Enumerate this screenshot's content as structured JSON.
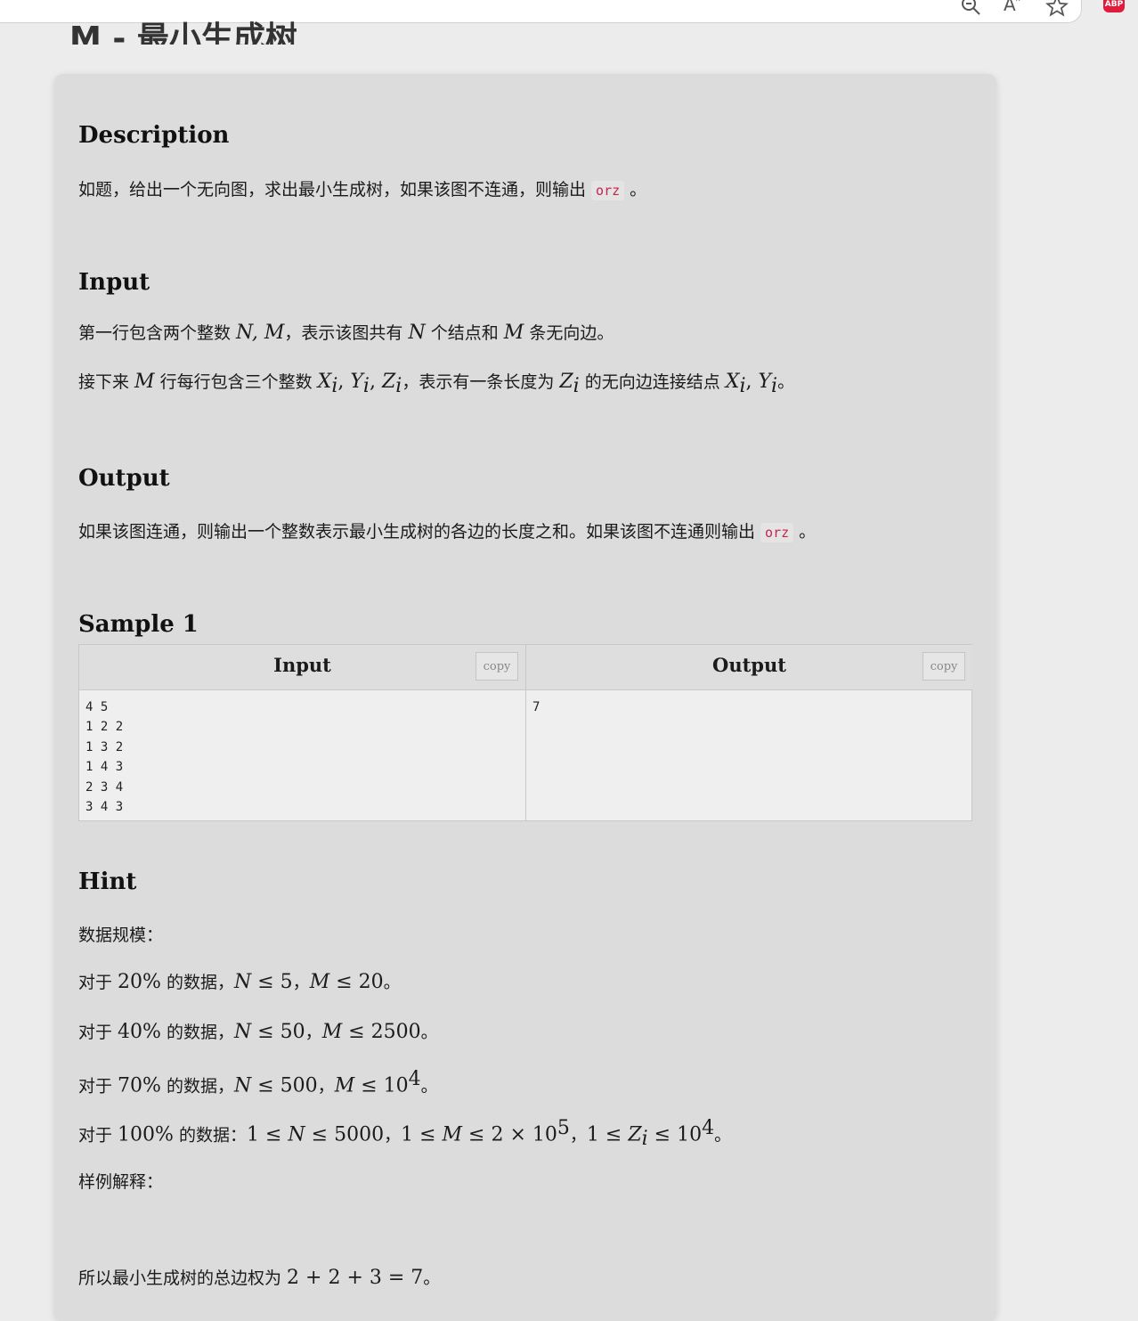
{
  "page": {
    "title": "M - 最小生成树"
  },
  "sections": {
    "description": {
      "title": "Description",
      "text_before": "如题，给出一个无向图，求出最小生成树，如果该图不连通，则输出 ",
      "code": "orz",
      "text_after": " 。"
    },
    "input": {
      "title": "Input",
      "line1": {
        "t1": "第一行包含两个整数 ",
        "m1": "N, M",
        "t2": "，表示该图共有 ",
        "m2": "N",
        "t3": " 个结点和 ",
        "m3": "M",
        "t4": " 条无向边。"
      },
      "line2": {
        "t1": "接下来 ",
        "m1": "M",
        "t2": " 行每行包含三个整数 ",
        "x": "X",
        "y": "Y",
        "z": "Z",
        "sub": "i",
        "t3": "，表示有一条长度为 ",
        "t4": " 的无向边连接结点 ",
        "t5": "。"
      }
    },
    "output": {
      "title": "Output",
      "text_before": "如果该图连通，则输出一个整数表示最小生成树的各边的长度之和。如果该图不连通则输出 ",
      "code": "orz",
      "text_after": " 。"
    },
    "sample": {
      "title": "Sample 1",
      "input_header": "Input",
      "output_header": "Output",
      "copy_label": "copy",
      "input_data": "4 5\n1 2 2\n1 3 2\n1 4 3\n2 3 4\n3 4 3",
      "output_data": "7"
    },
    "hint": {
      "title": "Hint",
      "scale_label": "数据规模：",
      "p1": {
        "a": "对于 ",
        "pct": "20%",
        "b": " 的数据，",
        "n": "N",
        "le": " ≤ ",
        "nv": "5",
        "sep": "，",
        "m": "M",
        "mv": "20",
        "end": "。"
      },
      "p2": {
        "a": "对于 ",
        "pct": "40%",
        "b": " 的数据，",
        "n": "N",
        "le": " ≤ ",
        "nv": "50",
        "sep": "，",
        "m": "M",
        "mv": "2500",
        "end": "。"
      },
      "p3": {
        "a": "对于 ",
        "pct": "70%",
        "b": " 的数据，",
        "n": "N",
        "le": " ≤ ",
        "nv": "500",
        "sep": "，",
        "m": "M",
        "mv": "10",
        "mexp": "4",
        "end": "。"
      },
      "p4": {
        "a": "对于 ",
        "pct": "100%",
        "b": " 的数据：",
        "c1": "1 ≤ ",
        "n": "N",
        "c2": " ≤ 5000",
        "sep1": "，",
        "c3": "1 ≤ ",
        "m": "M",
        "c4": " ≤ 2 × 10",
        "exp1": "5",
        "sep2": "，",
        "c5": "1 ≤ ",
        "z": "Z",
        "zsub": "i",
        "c6": " ≤ 10",
        "exp2": "4",
        "end": "。"
      },
      "explain_label": "样例解释：",
      "conclusion_text": "所以最小生成树的总边权为 ",
      "conclusion_math": "2 + 2 + 3 = 7",
      "conclusion_end": "。"
    }
  },
  "browser": {
    "icons": [
      "zoom-icon",
      "read-aloud-icon",
      "favorite-star-icon"
    ],
    "read_aloud_glyph": "A″",
    "adblock_badge": "ABP",
    "adblock_color": "#e01b3c"
  },
  "colors": {
    "code_text": "#c7254e",
    "card_bg": "#dcdcdc",
    "page_bg": "#ececec"
  }
}
